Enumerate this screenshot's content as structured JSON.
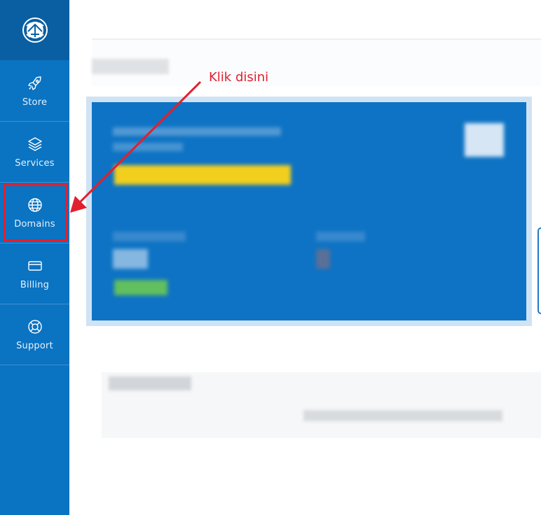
{
  "sidebar": {
    "logo_icon": "seal-logo-icon",
    "items": [
      {
        "label": "Store",
        "icon": "rocket-icon"
      },
      {
        "label": "Services",
        "icon": "layers-icon"
      },
      {
        "label": "Domains",
        "icon": "globe-icon"
      },
      {
        "label": "Billing",
        "icon": "credit-card-icon"
      },
      {
        "label": "Support",
        "icon": "lifebuoy-icon"
      }
    ]
  },
  "annotation": {
    "text": "Klik disini",
    "color": "#e0202f"
  },
  "colors": {
    "sidebar_bg": "#0a73c2",
    "logo_bg": "#0a5fa3",
    "hero_bg": "#0e73c4"
  }
}
